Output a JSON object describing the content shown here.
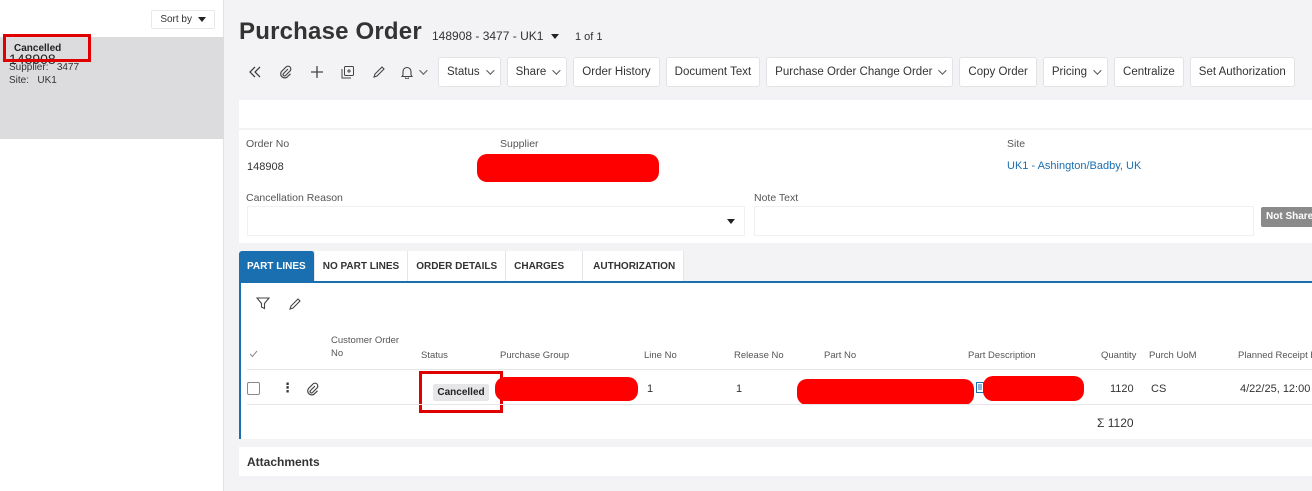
{
  "left_panel": {
    "sort_label": "Sort by",
    "record": {
      "title": "148908",
      "status": "Cancelled",
      "supplier_label": "Supplier:",
      "supplier_value": "3477",
      "site_label": "Site:",
      "site_value": "UK1"
    }
  },
  "header": {
    "title": "Purchase Order",
    "order_selector": "148908 - 3477 - UK1",
    "page_count": "1 of 1"
  },
  "toolbar": {
    "buttons": [
      "Status",
      "Share",
      "Order History",
      "Document Text",
      "Purchase Order Change Order",
      "Copy Order",
      "Pricing",
      "Centralize",
      "Set Authorization"
    ]
  },
  "form": {
    "order_no_label": "Order No",
    "order_no_value": "148908",
    "supplier_label": "Supplier",
    "site_label": "Site",
    "site_value": "UK1 - Ashington/Badby, UK",
    "cancellation_reason_label": "Cancellation Reason",
    "note_text_label": "Note Text",
    "not_shared_badge": "Not Share"
  },
  "tabs": [
    "PART LINES",
    "NO PART LINES",
    "ORDER DETAILS",
    "CHARGES",
    "AUTHORIZATION"
  ],
  "grid": {
    "columns": {
      "customer_order_no": "Customer Order No",
      "status": "Status",
      "purchase_group": "Purchase Group",
      "line_no": "Line No",
      "release_no": "Release No",
      "part_no": "Part No",
      "part_description": "Part Description",
      "quantity": "Quantity",
      "purch_uom": "Purch UoM",
      "planned_receipt": "Planned Receipt D"
    },
    "row": {
      "status": "Cancelled",
      "line_no": "1",
      "release_no": "1",
      "quantity": "1120",
      "purch_uom": "CS",
      "planned_receipt": "4/22/25, 12:00"
    },
    "sum": "Σ 1120"
  },
  "attachments_label": "Attachments",
  "colors": {
    "accent": "#1a6fb0",
    "highlight": "#e00000",
    "redaction": "#ff0000"
  }
}
